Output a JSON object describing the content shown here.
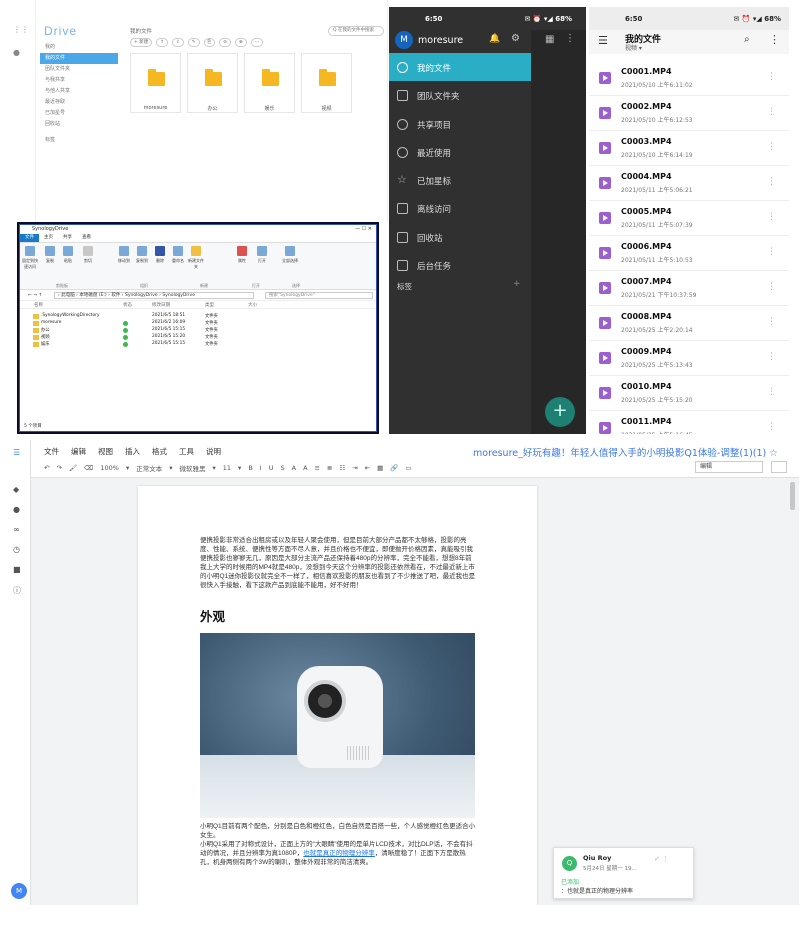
{
  "drive": {
    "logo": "Drive",
    "nav": [
      "我的",
      "我的文件",
      "团队文件夹",
      "与我共享",
      "与他人共享",
      "最近存取",
      "已加星号",
      "回收站",
      "标签"
    ],
    "crumb": "我的文件",
    "toolbar": [
      "+ 新建",
      "↑",
      "⇪",
      "✎",
      "⎘",
      "⊘",
      "⊕",
      "⋯"
    ],
    "search_placeholder": "Q 在我的文件中搜索",
    "folders": [
      "moresure",
      "办公",
      "娱乐",
      "视频"
    ]
  },
  "explorer": {
    "title": "SynologyDrive",
    "controls": "— ☐ ✕",
    "tabs": [
      "文件",
      "主页",
      "共享",
      "查看"
    ],
    "ribbon_buttons": [
      "固定到快速访问",
      "复制",
      "粘贴",
      "剪切",
      "移动到",
      "复制到",
      "删除",
      "重命名",
      "新建文件夹",
      "属性",
      "打开",
      "全部选择"
    ],
    "groups": [
      "剪贴板",
      "组织",
      "新建",
      "打开",
      "选择"
    ],
    "address": "› 此电脑 › 本地磁盘 (E:) › 软件 › SynologyDrive › SynologyDrive",
    "search": "搜索\"SynologyDrive\"",
    "cols": [
      "名称",
      "状态",
      "修改日期",
      "类型",
      "大小"
    ],
    "rows": [
      {
        "name": ".SynologyWorkingDirectory",
        "status": "",
        "date": "2021/6/5 18:51",
        "type": "文件夹"
      },
      {
        "name": "moresure",
        "status": "✓",
        "date": "2021/6/2 16:09",
        "type": "文件夹"
      },
      {
        "name": "办公",
        "status": "✓",
        "date": "2021/6/5 15:15",
        "type": "文件夹"
      },
      {
        "name": "视频",
        "status": "✓",
        "date": "2021/6/5 15:20",
        "type": "文件夹"
      },
      {
        "name": "娱乐",
        "status": "✓",
        "date": "2021/6/5 15:15",
        "type": "文件夹"
      }
    ],
    "status": "5 个项目"
  },
  "drawer": {
    "time": "6:50",
    "status_icons": "✉ ⏰ ▾◢ 68%",
    "user": "moresure",
    "avatar": "M",
    "items": [
      "我的文件",
      "团队文件夹",
      "共享项目",
      "最近使用",
      "已加星标",
      "离线访问",
      "回收站",
      "后台任务"
    ],
    "tags": "标签",
    "fab": "+"
  },
  "files": {
    "time": "6:50",
    "status_icons": "✉ ⏰ ▾◢ 68%",
    "title": "我的文件",
    "subtitle": "视频 ▾",
    "items": [
      {
        "name": "C0001.MP4",
        "date": "2021/05/10 上午6:11:02"
      },
      {
        "name": "C0002.MP4",
        "date": "2021/05/10 上午6:12:53"
      },
      {
        "name": "C0003.MP4",
        "date": "2021/05/10 上午6:14:19"
      },
      {
        "name": "C0004.MP4",
        "date": "2021/05/11 上午5:06:21"
      },
      {
        "name": "C0005.MP4",
        "date": "2021/05/11 上午5:07:39"
      },
      {
        "name": "C0006.MP4",
        "date": "2021/05/11 上午5:10:53"
      },
      {
        "name": "C0007.MP4",
        "date": "2021/05/21 下午10:37:59"
      },
      {
        "name": "C0008.MP4",
        "date": "2021/05/25 上午2:20:14"
      },
      {
        "name": "C0009.MP4",
        "date": "2021/05/25 上午5:13:43"
      },
      {
        "name": "C0010.MP4",
        "date": "2021/05/25 上午5:15:20"
      },
      {
        "name": "C0011.MP4",
        "date": "2021/05/25 上午5:16:45"
      }
    ]
  },
  "docs": {
    "menus": [
      "文件",
      "编辑",
      "视图",
      "插入",
      "格式",
      "工具",
      "说明"
    ],
    "title": "moresure_好玩有趣！年轻人值得入手的小明投影Q1体验-调整(1)(1) ☆",
    "format": [
      "↶",
      "↷",
      "🖌",
      "⌫",
      "100%",
      "▾",
      "正常文本",
      "▾",
      "微软雅黑",
      "▾",
      "11",
      "▾",
      "B",
      "I",
      "U",
      "S",
      "A",
      "A",
      "≡",
      "≣",
      "☷",
      "⇥",
      "⇤",
      "▦",
      "🔗",
      "▭"
    ],
    "mode": "编辑",
    "para1": "便携投影非常适合出租房或以及年轻人聚会使用，但是目前大部分产品都不太够格，投影的亮度、性能、系统、便携性等方面不尽人意，并且价格也不便宜，即便抛开价格因素，真能吸引我便携投影也寥寥无几，原因是大部分主流产品还保持着480p的分辨率，完全不能看，想想8年前我上大学的时候用的MP4就是480p，没想到今天这个分辨率的投影还依然看在，不过最近新上市的小明Q1迷你投影仪就完全不一样了，相信喜欢投影的朋友也看到了不少推送了吧，最近我也是很快入手接触，看下这款产品到底能不能用，好不好用！",
    "heading": "外观",
    "para2a": "小明Q1目前有两个配色，分别是白色和橙红色，白色自然是百搭一些，个人感觉橙红色更适合小女生。",
    "para2b": "小明Q1采用了对称式设计，正面上方的“大眼睛”使用的是单片LCD技术，对比DLP话，不会有抖动的情况，并且分辨率为真1080P，",
    "para2link": "也就是真正的物理分辨率",
    "para2c": "，清晰度稳了！正面下方是散热孔，机身两侧有两个3W的喇叭，整体外观非常的简洁清爽。",
    "comment": {
      "avatar": "Q",
      "name": "Qiu Roy",
      "time": "5月24日 星期一 19...",
      "actions": "✓ ⋮",
      "added": "已添加",
      "text": "：也就是真正的物理分辨率"
    },
    "avatar": "M"
  }
}
